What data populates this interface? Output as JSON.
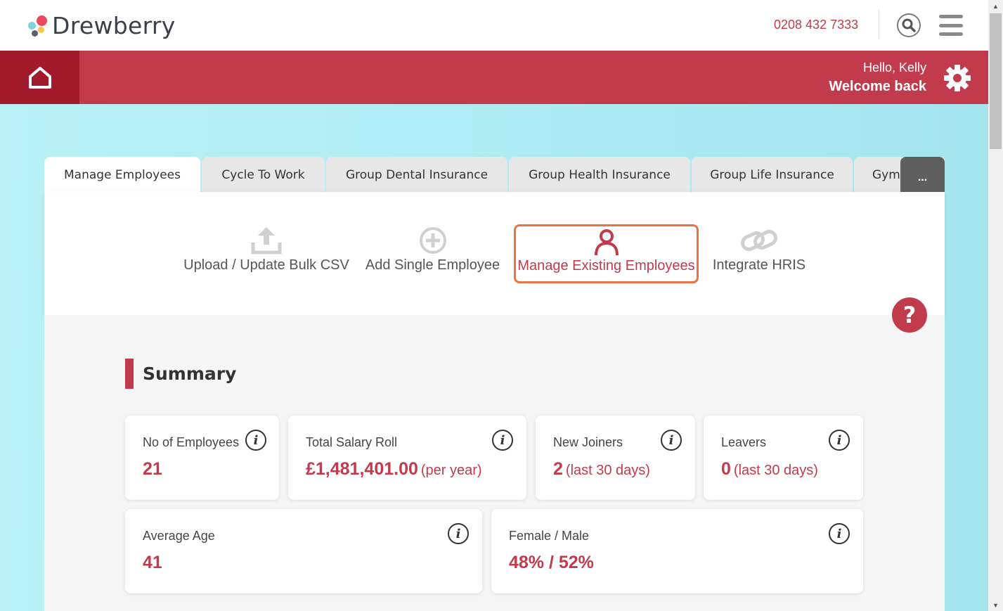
{
  "header": {
    "brand": "Drewberry",
    "phone": "0208 432 7333",
    "colors": {
      "brand_red": "#c23b4c",
      "dark_red": "#a11a2b",
      "logo_red": "#e84a5f",
      "logo_blue": "#7fd4e0",
      "logo_yellow": "#f6c64a",
      "logo_grey": "#5a6170"
    }
  },
  "banner": {
    "greeting": "Hello, Kelly",
    "welcome": "Welcome back"
  },
  "tabs": [
    {
      "label": "Manage Employees",
      "active": true
    },
    {
      "label": "Cycle To Work",
      "active": false
    },
    {
      "label": "Group Dental Insurance",
      "active": false
    },
    {
      "label": "Group Health Insurance",
      "active": false
    },
    {
      "label": "Group Life Insurance",
      "active": false
    },
    {
      "label": "Gym",
      "active": false
    }
  ],
  "more_tabs_label": "...",
  "actions": [
    {
      "label": "Upload / Update Bulk CSV",
      "icon": "upload-icon"
    },
    {
      "label": "Add Single Employee",
      "icon": "plus-circle-icon"
    },
    {
      "label": "Manage Existing Employees",
      "icon": "person-icon",
      "selected": true
    },
    {
      "label": "Integrate HRIS",
      "icon": "link-icon"
    }
  ],
  "help_label": "?",
  "summary": {
    "title": "Summary",
    "cards": [
      {
        "label": "No of Employees",
        "value": "21",
        "suffix": ""
      },
      {
        "label": "Total Salary Roll",
        "value": "£1,481,401.00",
        "suffix": "(per year)"
      },
      {
        "label": "New Joiners",
        "value": "2",
        "suffix": "(last 30 days)"
      },
      {
        "label": "Leavers",
        "value": "0",
        "suffix": "(last 30 days)"
      },
      {
        "label": "Average Age",
        "value": "41",
        "suffix": ""
      },
      {
        "label": "Female / Male",
        "value": "48% / 52%",
        "suffix": ""
      }
    ],
    "info_glyph": "i"
  }
}
